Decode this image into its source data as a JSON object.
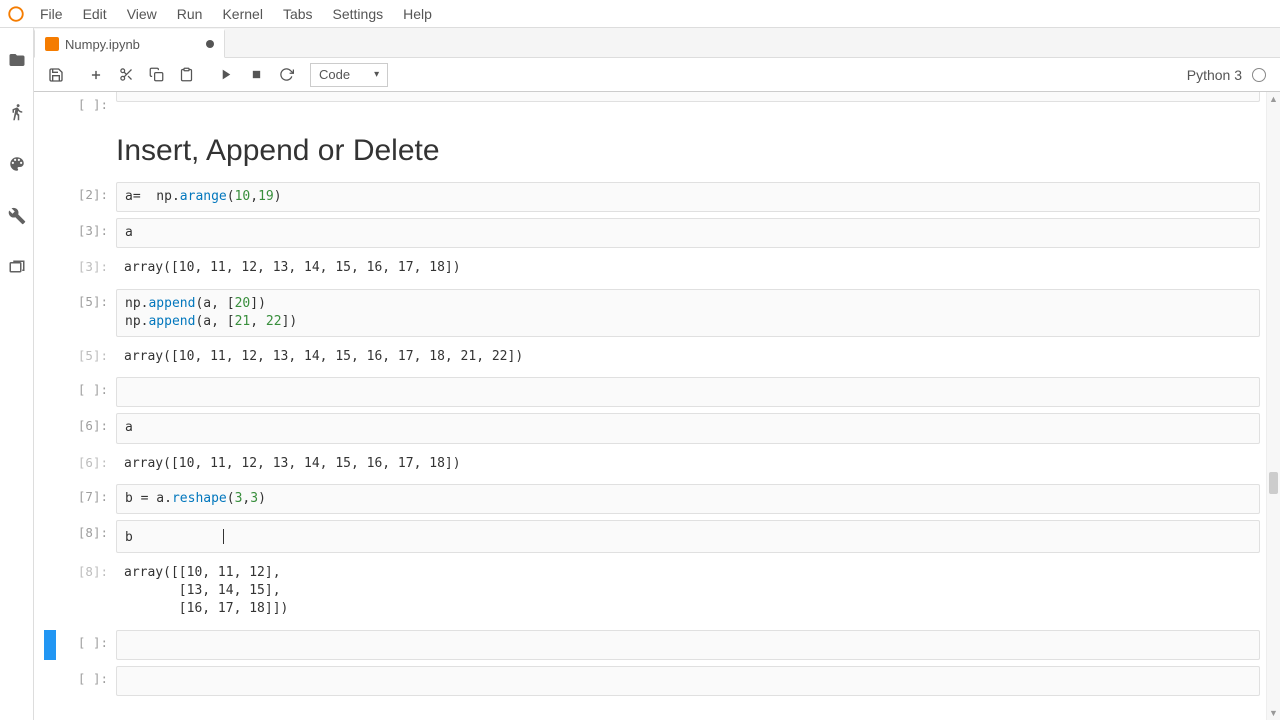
{
  "menubar": {
    "items": [
      "File",
      "Edit",
      "View",
      "Run",
      "Kernel",
      "Tabs",
      "Settings",
      "Help"
    ]
  },
  "sidebar_icons": [
    "folder-icon",
    "running-icon",
    "palette-icon",
    "wrench-icon",
    "tabs-icon"
  ],
  "tab": {
    "title": "Numpy.ipynb",
    "dirty": true
  },
  "toolbar": {
    "celltype": "Code",
    "kernel": "Python 3"
  },
  "notebook": {
    "heading": "Insert, Append or Delete",
    "cells": [
      {
        "type": "in",
        "prompt": "[2]:",
        "code_html": "a=  np.<span class='tok-func'>arange</span>(<span class='tok-num'>10</span>,<span class='tok-num'>19</span>)"
      },
      {
        "type": "in",
        "prompt": "[3]:",
        "code_html": "a"
      },
      {
        "type": "out",
        "prompt": "[3]:",
        "text": "array([10, 11, 12, 13, 14, 15, 16, 17, 18])"
      },
      {
        "type": "in",
        "prompt": "[5]:",
        "code_html": "np.<span class='tok-func'>append</span>(a, [<span class='tok-num'>20</span>])\nnp.<span class='tok-func'>append</span>(a, [<span class='tok-num'>21</span>, <span class='tok-num'>22</span>])"
      },
      {
        "type": "out",
        "prompt": "[5]:",
        "text": "array([10, 11, 12, 13, 14, 15, 16, 17, 18, 21, 22])"
      },
      {
        "type": "in",
        "prompt": "[ ]:",
        "code_html": ""
      },
      {
        "type": "in",
        "prompt": "[6]:",
        "code_html": "a"
      },
      {
        "type": "out",
        "prompt": "[6]:",
        "text": "array([10, 11, 12, 13, 14, 15, 16, 17, 18])"
      },
      {
        "type": "in",
        "prompt": "[7]:",
        "code_html": "b = a.<span class='tok-func'>reshape</span>(<span class='tok-num'>3</span>,<span class='tok-num'>3</span>)"
      },
      {
        "type": "in",
        "prompt": "[8]:",
        "code_html": "b<span class='caret'></span>"
      },
      {
        "type": "out",
        "prompt": "[8]:",
        "text": "array([[10, 11, 12],\n       [13, 14, 15],\n       [16, 17, 18]])"
      },
      {
        "type": "in",
        "prompt": "[ ]:",
        "code_html": "",
        "selected": true
      },
      {
        "type": "in",
        "prompt": "[ ]:",
        "code_html": ""
      }
    ]
  }
}
